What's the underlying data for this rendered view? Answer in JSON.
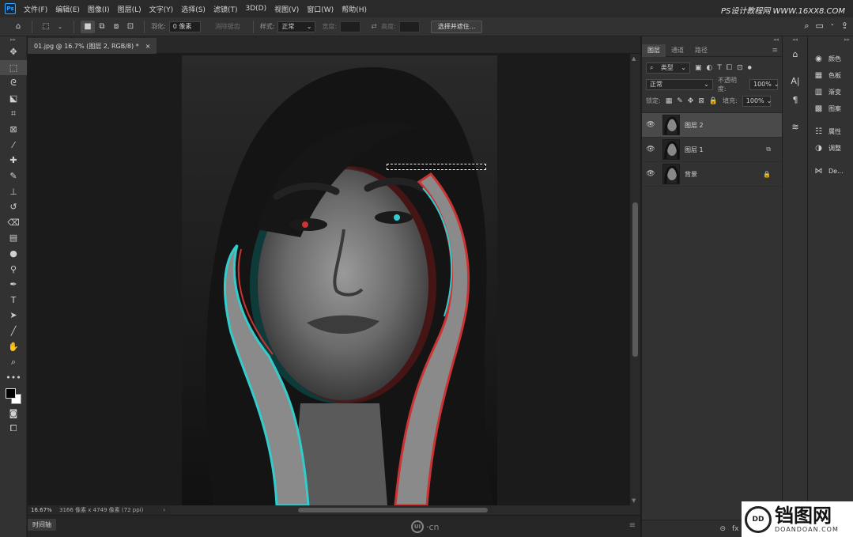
{
  "app": {
    "logo": "Ps",
    "watermark": "PS设计教程网 WWW.16XX8.COM"
  },
  "menu": [
    "文件(F)",
    "编辑(E)",
    "图像(I)",
    "图层(L)",
    "文字(Y)",
    "选择(S)",
    "滤镜(T)",
    "3D(D)",
    "视图(V)",
    "窗口(W)",
    "帮助(H)"
  ],
  "options": {
    "feather_label": "羽化:",
    "feather_value": "0 像素",
    "antialias_label": "消除锯齿",
    "style_label": "样式:",
    "style_value": "正常",
    "width_label": "宽度:",
    "height_label": "高度:",
    "select_mask_label": "选择并遮住..."
  },
  "document": {
    "tab_title": "01.jpg @ 16.7% (图层 2, RGB/8) *",
    "close_glyph": "×",
    "zoom": "16.67%",
    "info": "3166 像素 x 4749 像素 (72 ppi)",
    "info_arrow": "›"
  },
  "timeline": {
    "label": "时间轴",
    "logo": "UI",
    "logo_suffix": "·cn"
  },
  "layers_panel": {
    "tabs": [
      "图层",
      "通道",
      "路径"
    ],
    "filter_kind": "类型",
    "blend_mode": "正常",
    "opacity_label": "不透明度:",
    "opacity_value": "100%",
    "lock_label": "锁定:",
    "fill_label": "填充:",
    "fill_value": "100%",
    "layers": [
      {
        "name": "图层 2",
        "selected": true,
        "badge": ""
      },
      {
        "name": "图层 1",
        "selected": false,
        "badge": "⧉"
      },
      {
        "name": "背景",
        "selected": false,
        "badge": "🔒"
      }
    ]
  },
  "right_panel": {
    "items": [
      {
        "icon": "color-icon",
        "label": "颜色"
      },
      {
        "icon": "swatches-icon",
        "label": "色板"
      },
      {
        "icon": "gradient-icon",
        "label": "渐变"
      },
      {
        "icon": "pattern-icon",
        "label": "图案"
      },
      {
        "icon": "properties-icon",
        "label": "属性"
      },
      {
        "icon": "adjustments-icon",
        "label": "调整"
      },
      {
        "icon": "device-preview-icon",
        "label": "De..."
      }
    ]
  },
  "watermark_bottom": {
    "title": "铛图网",
    "sub": "DOANDOAN.COM",
    "logo": "DD"
  }
}
